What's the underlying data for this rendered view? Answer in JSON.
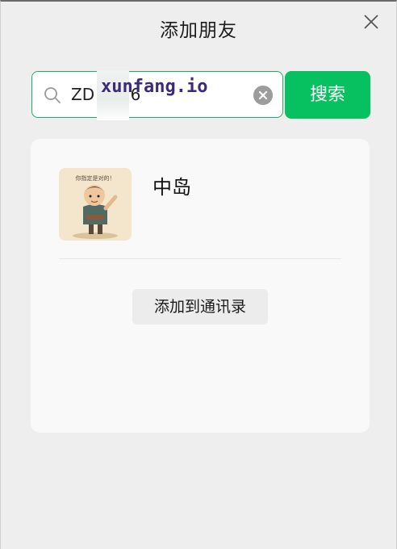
{
  "window": {
    "title": "添加朋友"
  },
  "search": {
    "query": "ZD 5676",
    "placeholder": "",
    "button_label": "搜索"
  },
  "watermark": {
    "text": "xunfang.io"
  },
  "result": {
    "name": "中岛",
    "avatar_caption": "你指定是对的！",
    "add_button_label": "添加到通讯录"
  },
  "colors": {
    "accent": "#07c160",
    "input_border": "#1aad6a",
    "watermark": "#3d2b7a"
  },
  "icons": {
    "close": "close-icon",
    "search": "search-icon",
    "clear": "clear-icon"
  }
}
